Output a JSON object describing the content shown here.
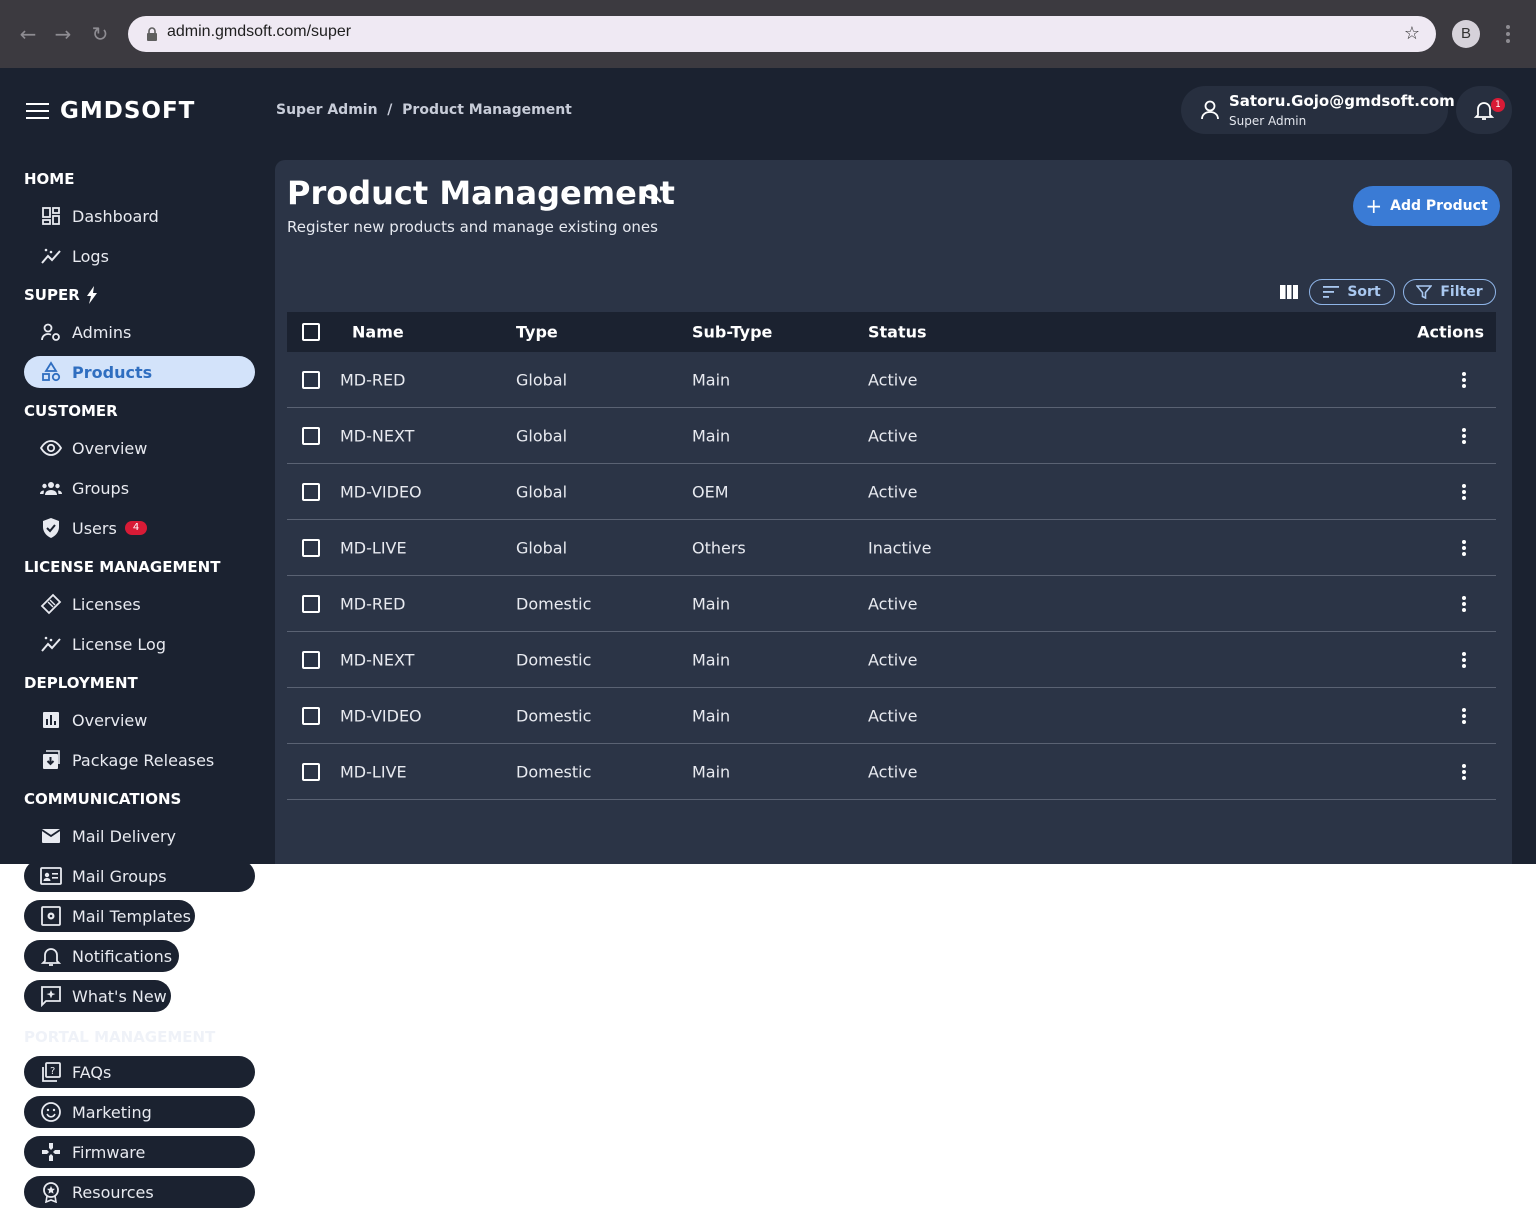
{
  "browser": {
    "url": "admin.gmdsoft.com/super",
    "profile_initial": "B"
  },
  "app": {
    "logo": "GMDSOFT",
    "breadcrumb": "Super Admin  /  Product Management",
    "user": {
      "email": "Satoru.Gojo@gmdsoft.com",
      "role": "Super Admin"
    },
    "notification_count": "1"
  },
  "sidebar": {
    "home": "HOME",
    "dashboard": "Dashboard",
    "logs": "Logs",
    "super": "SUPER",
    "admins": "Admins",
    "products": "Products",
    "customer": "CUSTOMER",
    "overview": "Overview",
    "groups": "Groups",
    "users": "Users",
    "users_badge": "4",
    "license_management": "LICENSE MANAGEMENT",
    "licenses": "Licenses",
    "license_log": "License Log",
    "deployment": "DEPLOYMENT",
    "deploy_overview": "Overview",
    "package_releases": "Package Releases",
    "communications": "COMMUNICATIONS",
    "mail_delivery": "Mail Delivery",
    "mail_groups": "Mail Groups",
    "mail_templates": "Mail Templates",
    "notifications": "Notifications",
    "whats_new": "What's New",
    "portal_management": "PORTAL MANAGEMENT",
    "faqs": "FAQs",
    "marketing": "Marketing",
    "firmware": "Firmware",
    "resources": "Resources"
  },
  "page": {
    "title": "Product Management",
    "subtitle": "Register new products and manage existing ones",
    "add_label": "Add Product",
    "sort_label": "Sort",
    "filter_label": "Filter"
  },
  "table": {
    "headers": {
      "name": "Name",
      "type": "Type",
      "subtype": "Sub-Type",
      "status": "Status",
      "actions": "Actions"
    },
    "rows": [
      {
        "name": "MD-RED",
        "type": "Global",
        "subtype": "Main",
        "status": "Active"
      },
      {
        "name": "MD-NEXT",
        "type": "Global",
        "subtype": "Main",
        "status": "Active"
      },
      {
        "name": "MD-VIDEO",
        "type": "Global",
        "subtype": "OEM",
        "status": "Active"
      },
      {
        "name": "MD-LIVE",
        "type": "Global",
        "subtype": "Others",
        "status": "Inactive"
      },
      {
        "name": "MD-RED",
        "type": "Domestic",
        "subtype": "Main",
        "status": "Active"
      },
      {
        "name": "MD-NEXT",
        "type": "Domestic",
        "subtype": "Main",
        "status": "Active"
      },
      {
        "name": "MD-VIDEO",
        "type": "Domestic",
        "subtype": "Main",
        "status": "Active"
      },
      {
        "name": "MD-LIVE",
        "type": "Domestic",
        "subtype": "Main",
        "status": "Active"
      }
    ]
  }
}
